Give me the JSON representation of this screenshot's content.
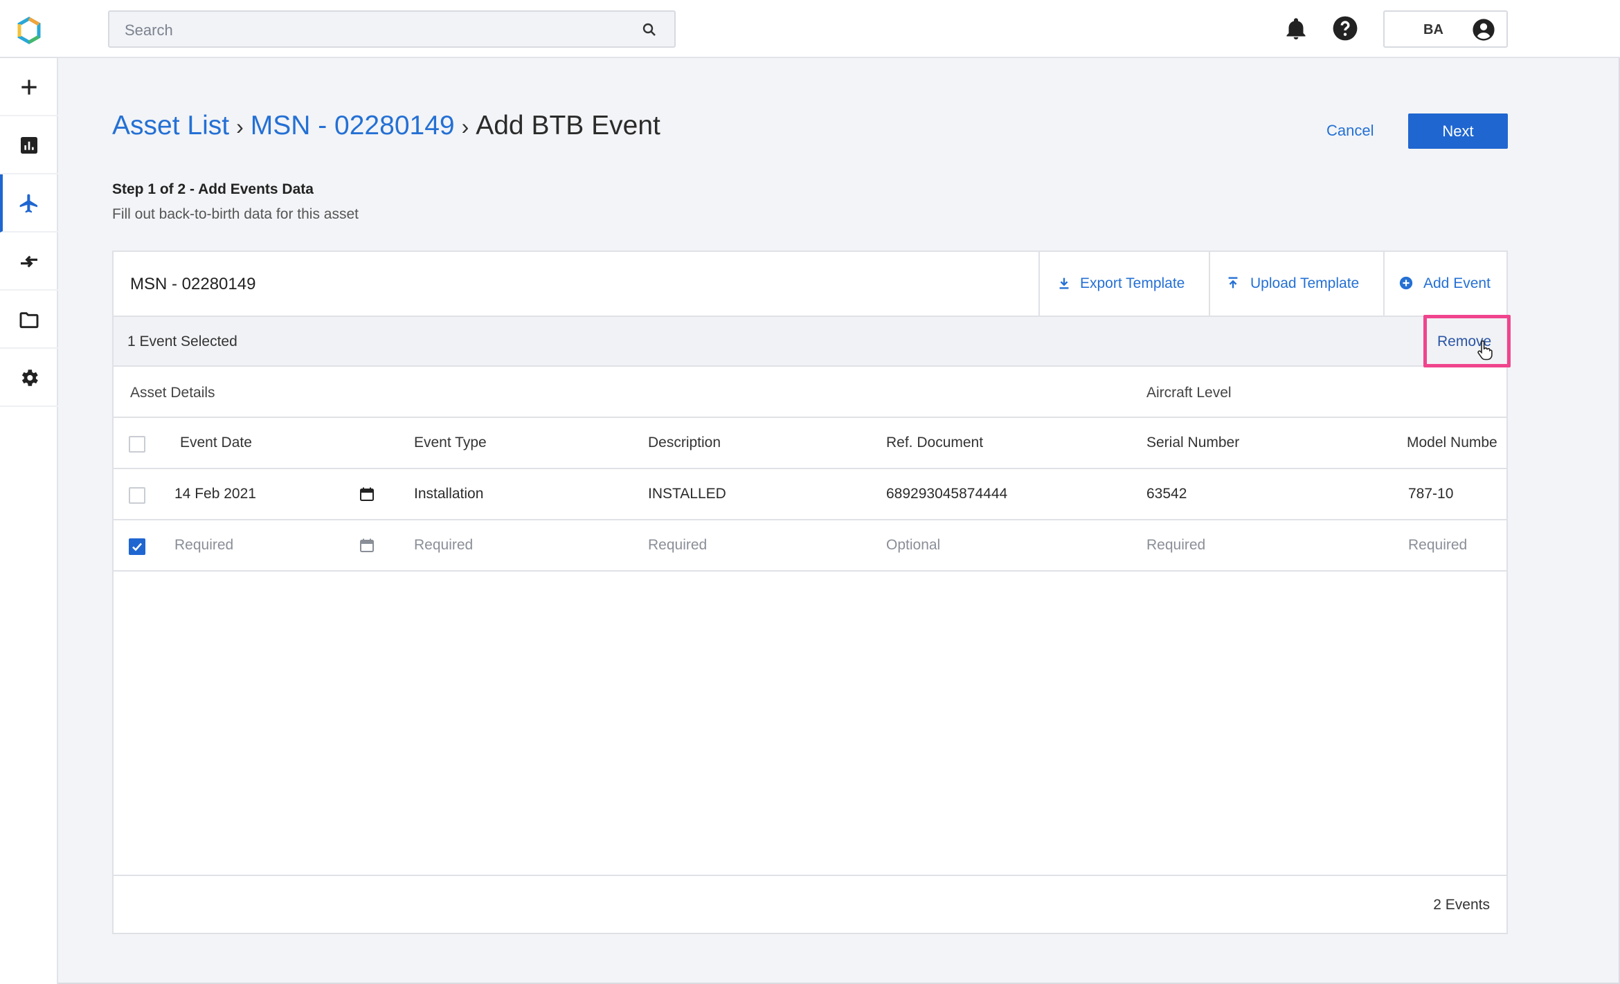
{
  "search": {
    "placeholder": "Search"
  },
  "user": {
    "initials": "BA"
  },
  "breadcrumb": {
    "root": "Asset List",
    "asset": "MSN - 02280149",
    "current": "Add BTB Event",
    "separator": "›"
  },
  "actions": {
    "cancel": "Cancel",
    "next": "Next"
  },
  "step": {
    "title": "Step 1 of 2 - Add Events Data",
    "subtitle": "Fill out back-to-birth data for this asset"
  },
  "card": {
    "title": "MSN - 02280149",
    "export_template": "Export Template",
    "upload_template": "Upload Template",
    "add_event": "Add Event"
  },
  "selection": {
    "count_label": "1 Event Selected",
    "remove": "Remove"
  },
  "groups": {
    "asset_details": "Asset Details",
    "aircraft_level": "Aircraft Level"
  },
  "columns": [
    "Event Date",
    "Event Type",
    "Description",
    "Ref. Document",
    "Serial Number",
    "Model Numbe"
  ],
  "rows": [
    {
      "checked": false,
      "cells": [
        "14 Feb 2021",
        "Installation",
        "INSTALLED",
        "689293045874444",
        "63542",
        "787-10"
      ]
    },
    {
      "checked": true,
      "cells": [
        "Required",
        "Required",
        "Required",
        "Optional",
        "Required",
        "Required"
      ]
    }
  ],
  "footer": {
    "total": "2 Events"
  },
  "colors": {
    "accent": "#1f66d1",
    "link": "#2470d4",
    "highlight": "#f0448d"
  }
}
